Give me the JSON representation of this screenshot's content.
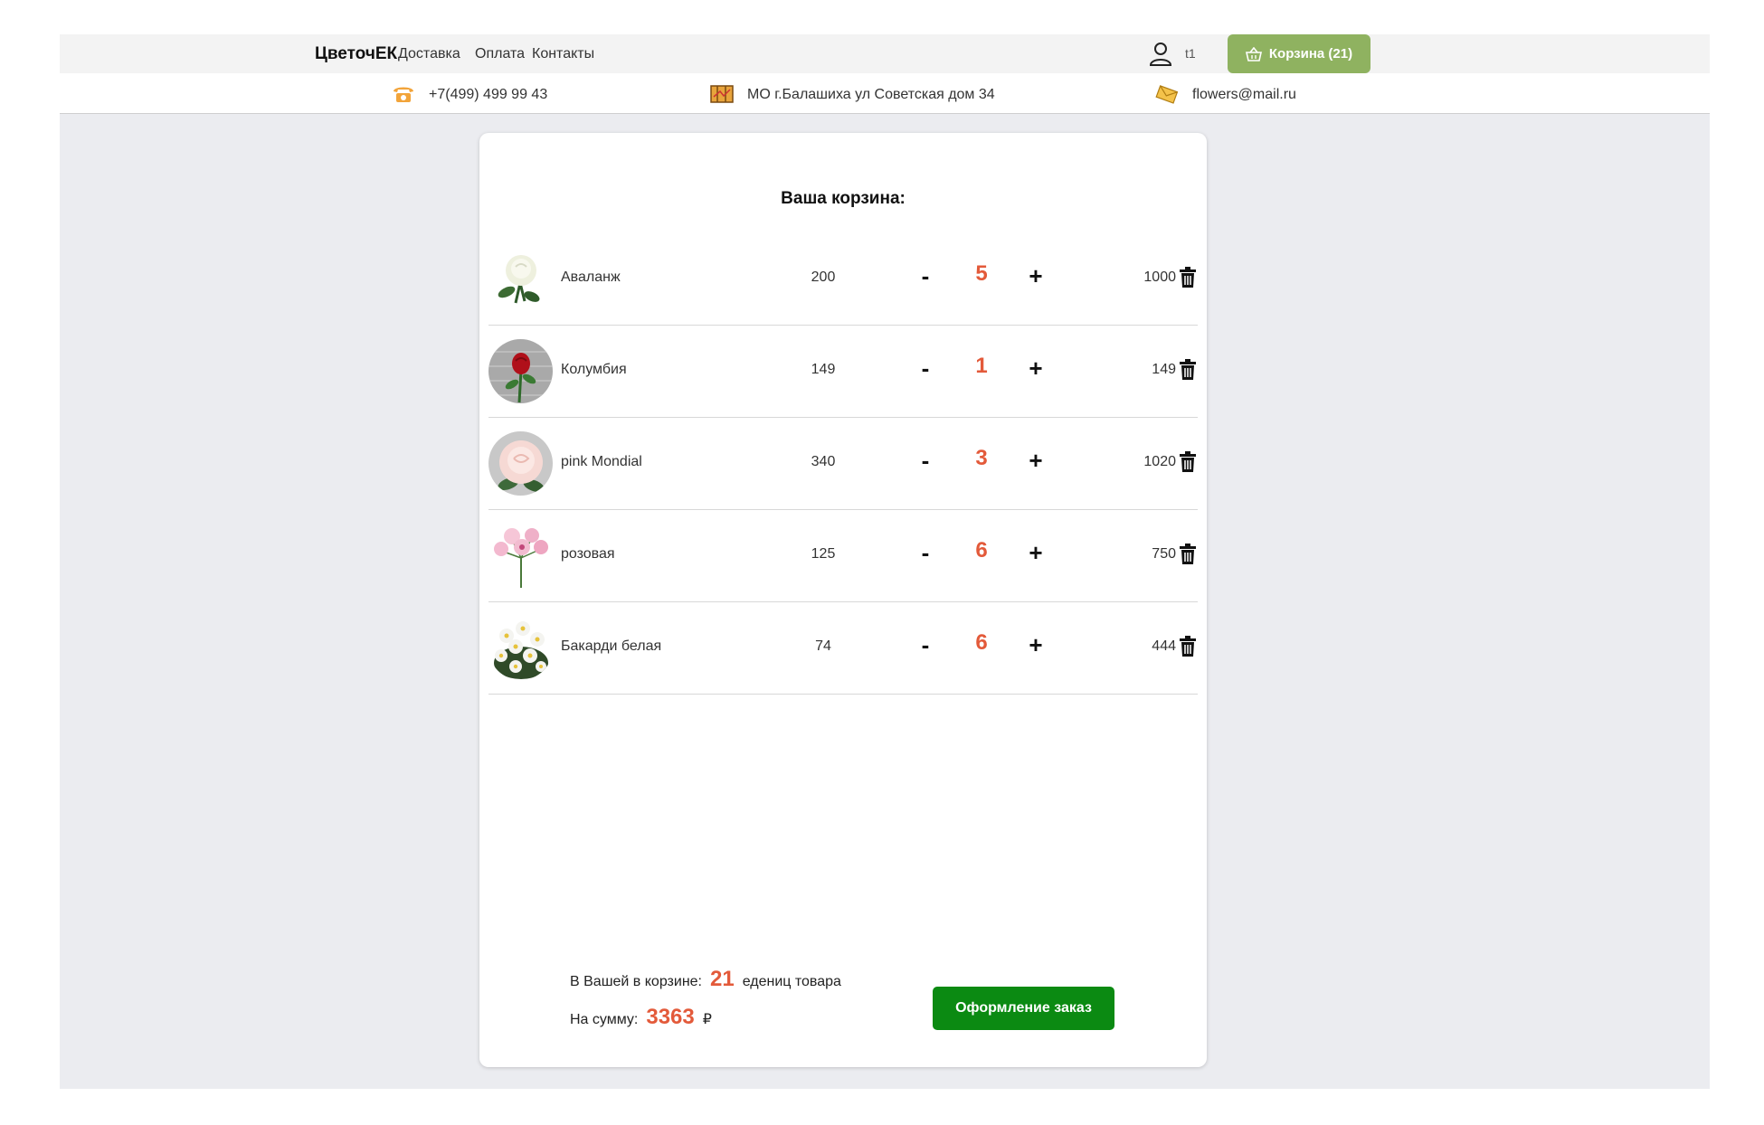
{
  "header": {
    "brand": "ЦветочЕК",
    "nav": [
      "Доставка",
      "Оплата",
      "Контакты"
    ],
    "user": "t1",
    "cart_button": "Корзина (21)"
  },
  "contacts": {
    "phone": "+7(499) 499 99 43",
    "address": "МО г.Балашиха ул Советская дом 34",
    "email": "flowers@mail.ru"
  },
  "cart": {
    "title": "Ваша корзина:",
    "minus_label": "-",
    "plus_label": "+",
    "items": [
      {
        "name": "Аваланж",
        "price": "200",
        "qty": "5",
        "total": "1000",
        "flower": "white-rose"
      },
      {
        "name": "Колумбия",
        "price": "149",
        "qty": "1",
        "total": "149",
        "flower": "red-rose"
      },
      {
        "name": "pink Mondial",
        "price": "340",
        "qty": "3",
        "total": "1020",
        "flower": "pink-rose"
      },
      {
        "name": "розовая",
        "price": "125",
        "qty": "6",
        "total": "750",
        "flower": "pink-lily"
      },
      {
        "name": "Бакарди белая",
        "price": "74",
        "qty": "6",
        "total": "444",
        "flower": "white-chrysanthemum"
      }
    ]
  },
  "summary": {
    "count_prefix": "В Вашей в корзине:",
    "count": "21",
    "count_suffix": "едениц товара",
    "sum_prefix": "На сумму:",
    "sum": "3363",
    "currency": "₽"
  },
  "checkout_label": "Оформление заказ",
  "colors": {
    "accent_green": "#8fb260",
    "checkout_green": "#0b8a12",
    "qty_red": "#e35a3a",
    "page_bg": "#ebecf0"
  }
}
